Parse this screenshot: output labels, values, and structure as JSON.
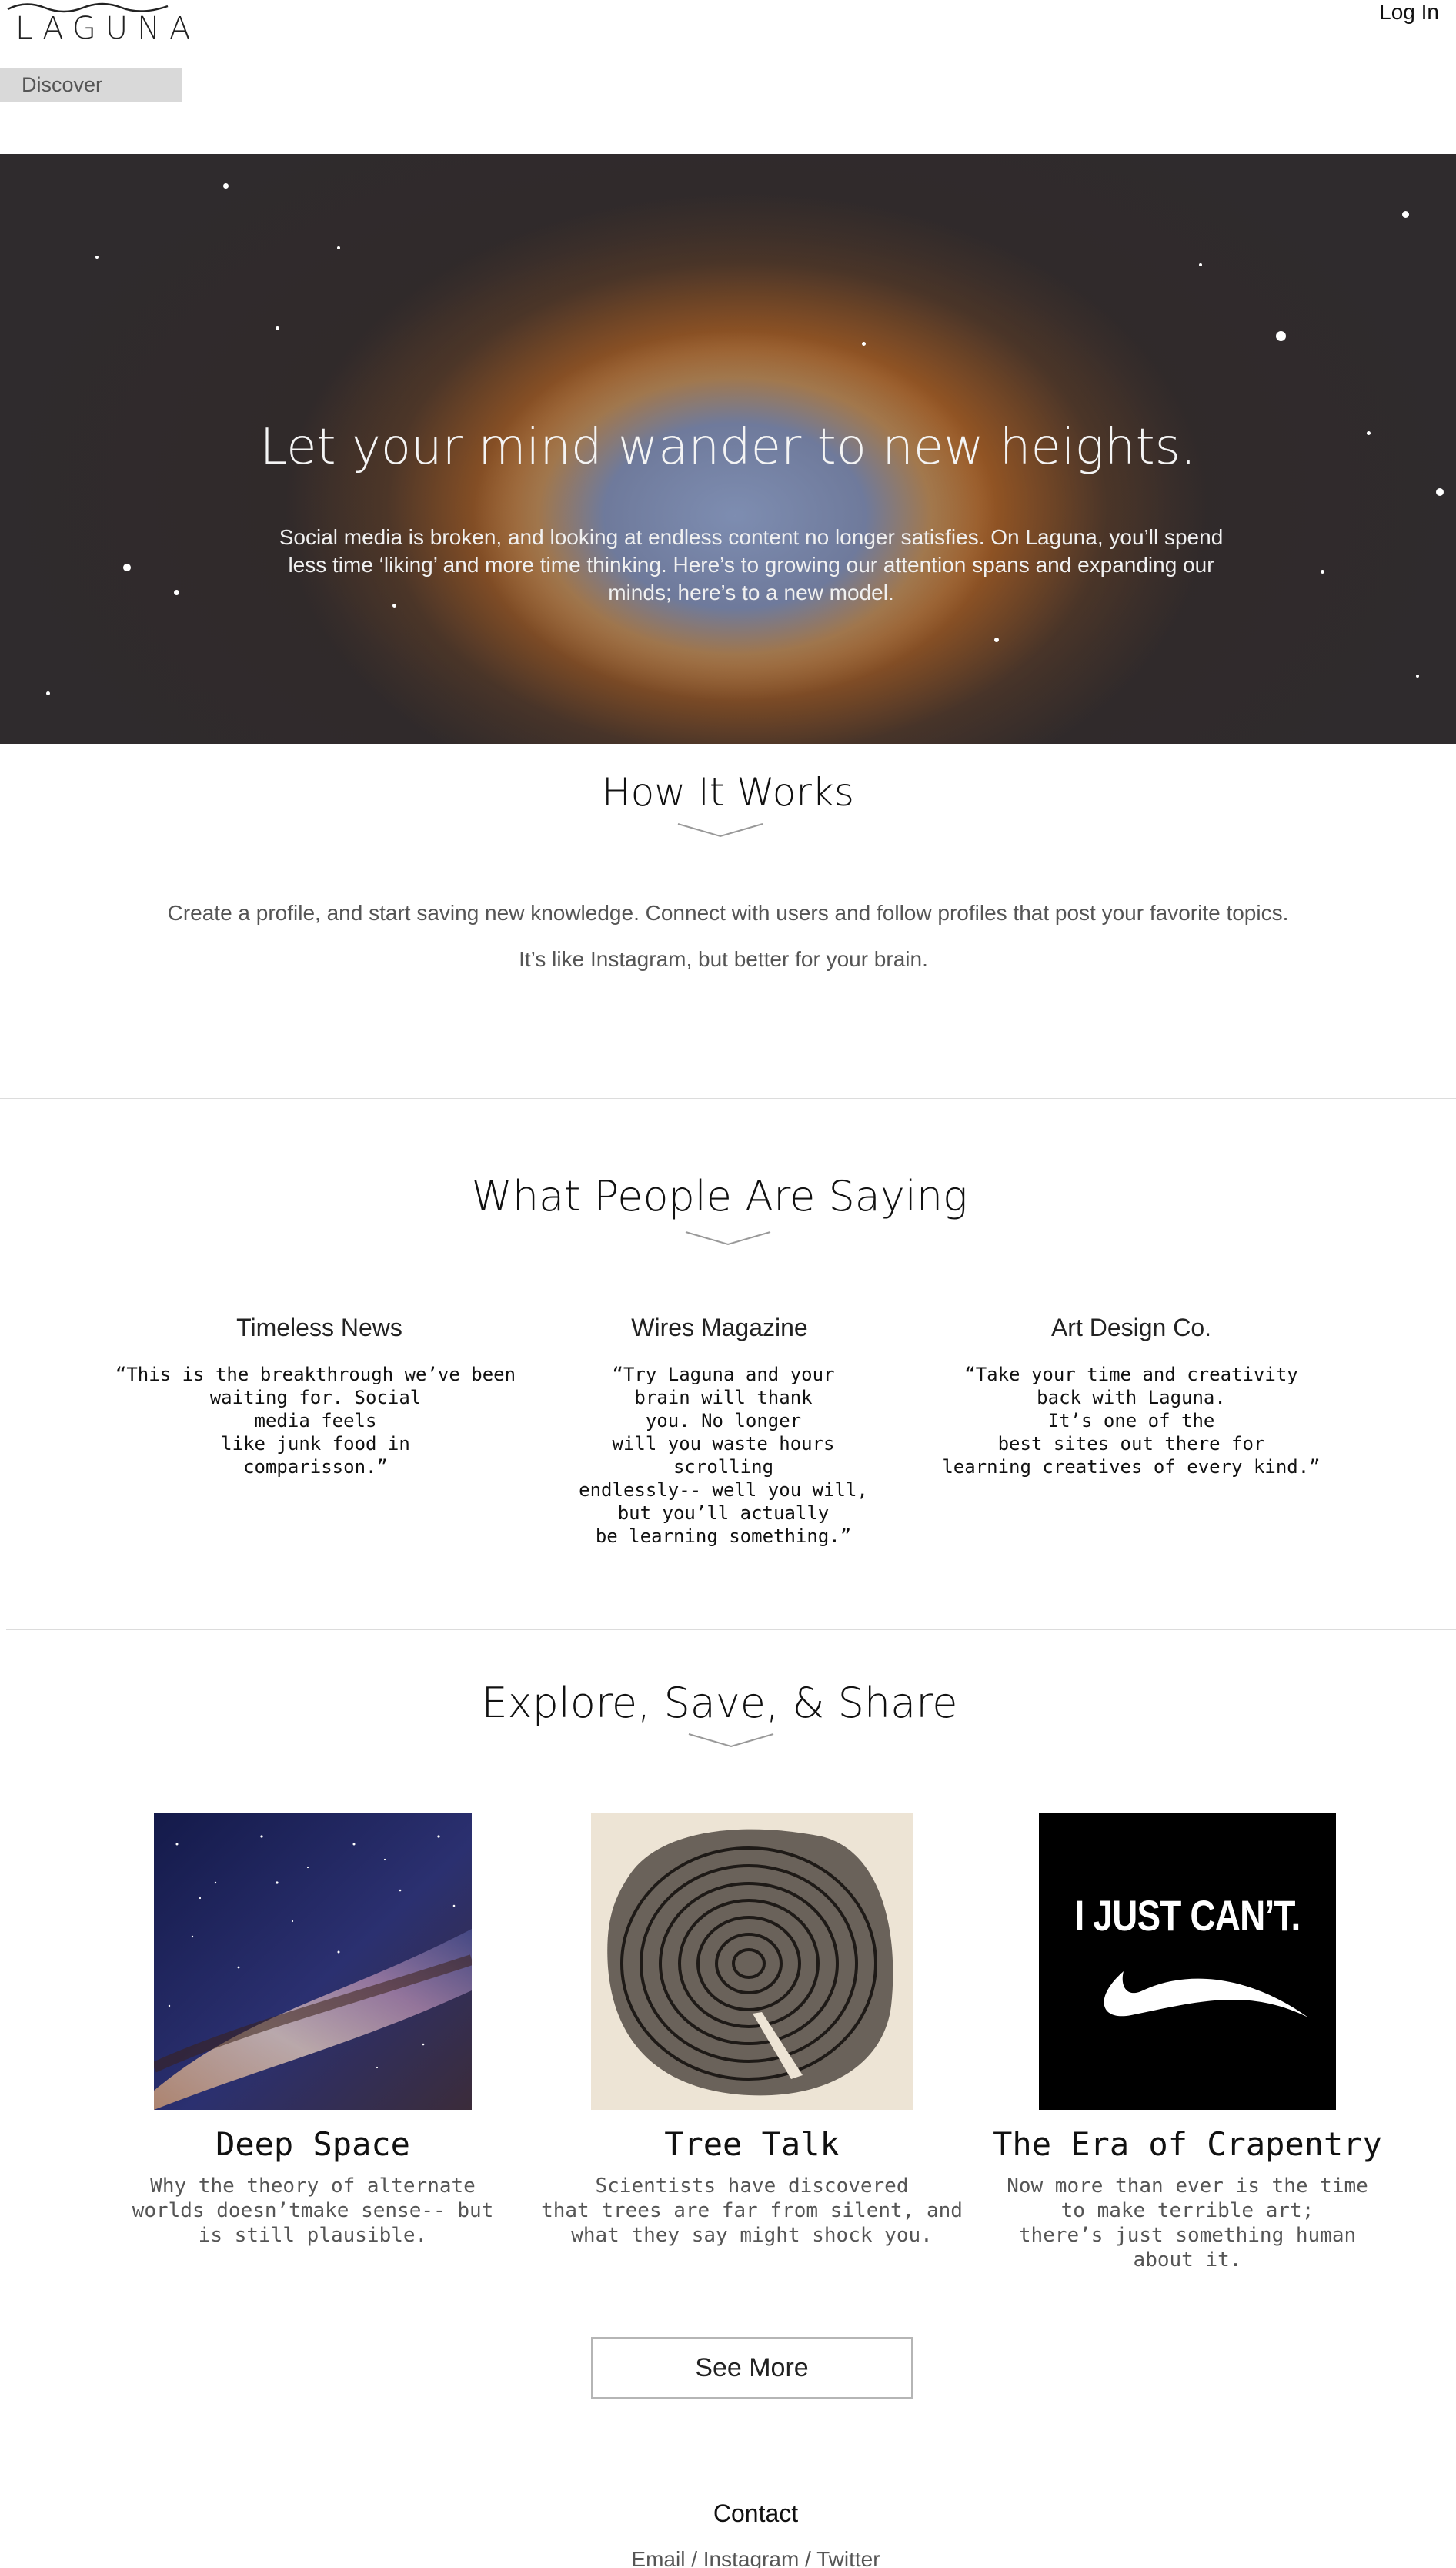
{
  "header": {
    "logo": "LAGUNA",
    "login_label": "Log In",
    "discover_label": "Discover"
  },
  "hero": {
    "title": "Let your mind wander to new heights.",
    "body": "Social media is broken, and looking at endless content no longer satisfies. On Laguna, you’ll spend less time ‘liking’ and more time thinking. Here’s to growing our attention spans and expanding our minds; here’s to a new model."
  },
  "how_it_works": {
    "title": "How It Works",
    "line1": "Create a profile, and start saving new knowledge. Connect with users and follow profiles that post your favorite topics.",
    "line2": "It’s like Instagram, but better for your brain."
  },
  "testimonials": {
    "title": "What People Are Saying",
    "items": [
      {
        "name": "Timeless News",
        "quote": "“This is the breakthrough we’ve been\nwaiting for. Social\nmedia feels\nlike junk food in\ncomparisson.”"
      },
      {
        "name": "Wires Magazine",
        "quote": "“Try Laguna and your\nbrain will thank\nyou. No longer\nwill you waste hours\nscrolling\nendlessly-- well you will,\nbut you’ll actually\nbe learning something.”"
      },
      {
        "name": "Art Design Co.",
        "quote": "“Take your time and creativity\nback with Laguna.\nIt’s one of the\nbest sites out there for\nlearning creatives of every kind.”"
      }
    ]
  },
  "explore": {
    "title": "Explore, Save, & Share",
    "cards": [
      {
        "title": "Deep Space",
        "desc": "Why the theory of alternate\nworlds doesn’tmake sense-- but\nis still plausible."
      },
      {
        "title": "Tree Talk",
        "desc": "Scientists have discovered\nthat trees are far from silent, and\nwhat they say might shock you."
      },
      {
        "title": "The Era of Crapentry",
        "desc": "Now more than ever is the time\nto make terrible art;\nthere’s just something human\nabout it.",
        "image_text": "I JUST CAN’T."
      }
    ],
    "see_more_label": "See More"
  },
  "contact": {
    "title": "Contact",
    "links": [
      "Email",
      "Instagram",
      "Twitter"
    ],
    "separator": " / "
  }
}
